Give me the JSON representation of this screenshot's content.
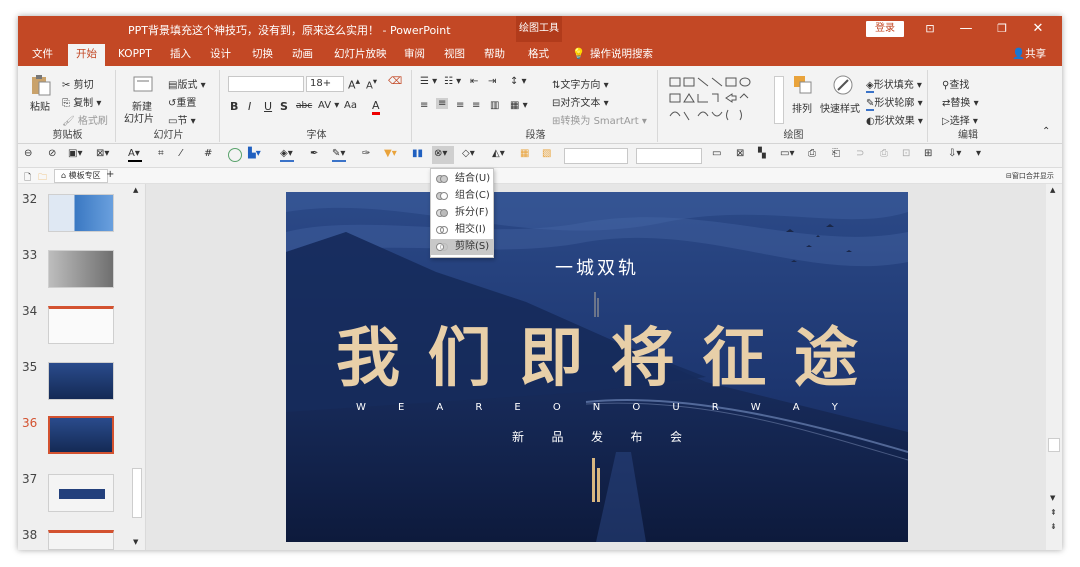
{
  "window": {
    "title": "PPT背景填充这个神技巧，没有到，原来这么实用！ - PowerPoint",
    "context_tab": "绘图工具",
    "login_label": "登录",
    "share_label": "共享"
  },
  "tabs": [
    "文件",
    "开始",
    "KOPPT",
    "插入",
    "设计",
    "切换",
    "动画",
    "幻灯片放映",
    "审阅",
    "视图",
    "帮助",
    "格式"
  ],
  "active_tab": "开始",
  "tell_me": "操作说明搜索",
  "ribbon": {
    "clipboard": {
      "label": "剪贴板",
      "paste": "粘贴",
      "cut": "剪切",
      "copy": "复制",
      "format_painter": "格式刷"
    },
    "slides": {
      "label": "幻灯片",
      "new_slide_1": "新建",
      "new_slide_2": "幻灯片",
      "layout": "版式",
      "reset": "重置",
      "section": "节"
    },
    "font": {
      "label": "字体",
      "size": "18+",
      "change_case": "Aa"
    },
    "paragraph": {
      "label": "段落",
      "text_direction": "文字方向",
      "align_text": "对齐文本",
      "smartart": "转换为 SmartArt"
    },
    "drawing": {
      "label": "绘图",
      "arrange": "排列",
      "quick_styles": "快速样式",
      "shape_fill": "形状填充",
      "shape_outline": "形状轮廓",
      "shape_effects": "形状效果"
    },
    "editing": {
      "label": "编辑",
      "find": "查找",
      "replace": "替换",
      "select": "选择"
    }
  },
  "tabbar": {
    "template_zone": "模板专区",
    "merge_display": "窗口合并显示"
  },
  "thumbnails": [
    {
      "num": "32"
    },
    {
      "num": "33"
    },
    {
      "num": "34"
    },
    {
      "num": "35"
    },
    {
      "num": "36",
      "selected": true
    },
    {
      "num": "37"
    },
    {
      "num": "38"
    }
  ],
  "merge_menu": [
    {
      "label": "结合(U)"
    },
    {
      "label": "组合(C)"
    },
    {
      "label": "拆分(F)"
    },
    {
      "label": "相交(I)"
    },
    {
      "label": "剪除(S)",
      "highlighted": true
    }
  ],
  "slide": {
    "subtitle_top": "一城双轨",
    "main_title": [
      "我",
      "们",
      "即",
      "将",
      "征",
      "途"
    ],
    "english": [
      "W",
      "E",
      "A",
      "R",
      "E",
      "O",
      "N",
      "O",
      "U",
      "R",
      "W",
      "A",
      "Y"
    ],
    "event": [
      "新",
      "品",
      "发",
      "布",
      "会"
    ]
  },
  "colors": {
    "accent": "#c34825",
    "title_gold": "#e8cfa8",
    "slide_bg": "#1d3468"
  }
}
